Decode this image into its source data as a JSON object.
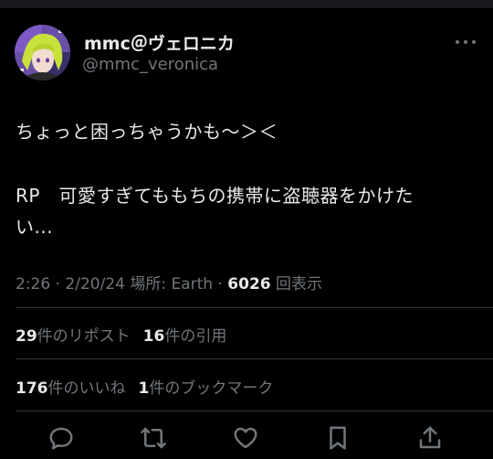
{
  "user": {
    "display_name": "mmc＠ヴェロニカ",
    "handle": "@mmc_veronica",
    "avatar_icon": "avatar-image"
  },
  "tweet": {
    "line1": "ちょっと困っちゃうかも〜＞＜",
    "line2": "RP　可愛すぎてももちの携帯に盗聴器をかけた",
    "line3": "い..."
  },
  "meta": {
    "time": "2:26",
    "sep1": " · ",
    "date": "2/20/24",
    "place": " 場所: Earth · ",
    "views": "6026",
    "views_label": " 回表示"
  },
  "stats": {
    "reposts": "29",
    "reposts_label": "件のリポスト",
    "quotes": "16",
    "quotes_label": "件の引用",
    "likes": "176",
    "likes_label": "件のいいね",
    "bookmarks": "1",
    "bookmarks_label": "件のブックマーク"
  },
  "actions": [
    "reply-icon",
    "retweet-icon",
    "like-icon",
    "bookmark-icon",
    "share-icon"
  ],
  "colors": {
    "background": "#000000",
    "text": "#e7e9ea",
    "secondary": "#71767b",
    "divider": "#2f3336"
  }
}
